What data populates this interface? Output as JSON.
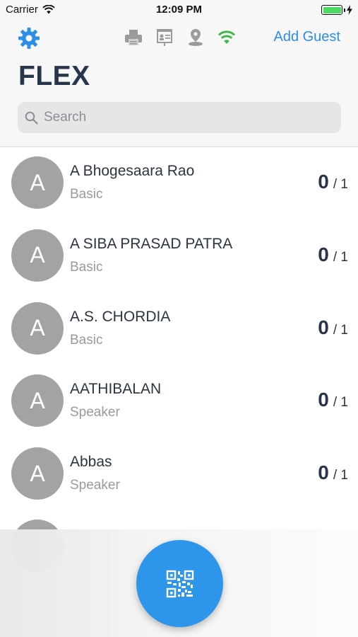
{
  "status_bar": {
    "carrier": "Carrier",
    "time": "12:09 PM"
  },
  "header": {
    "settings_icon": "gear-icon",
    "tool_icons": [
      "printer-icon",
      "badge-icon",
      "location-pin-icon",
      "wifi-icon"
    ],
    "add_guest_label": "Add Guest",
    "title": "FLEX"
  },
  "search": {
    "placeholder": "Search",
    "value": ""
  },
  "guests": [
    {
      "initial": "A",
      "name": "A Bhogesaara Rao",
      "type": "Basic",
      "checked": "0",
      "total": "/ 1"
    },
    {
      "initial": "A",
      "name": "A SIBA PRASAD PATRA",
      "type": "Basic",
      "checked": "0",
      "total": "/ 1"
    },
    {
      "initial": "A",
      "name": "A.S. CHORDIA",
      "type": "Basic",
      "checked": "0",
      "total": "/ 1"
    },
    {
      "initial": "A",
      "name": "AATHIBALAN",
      "type": "Speaker",
      "checked": "0",
      "total": "/ 1"
    },
    {
      "initial": "A",
      "name": "Abbas",
      "type": "Speaker",
      "checked": "0",
      "total": "/ 1"
    }
  ],
  "scan_button": {
    "icon": "qr-code-icon"
  },
  "colors": {
    "accent": "#2d8ee6",
    "wifi_connected": "#3db84a",
    "avatar": "#a3a3a3",
    "scan_button": "#2d95ea"
  }
}
